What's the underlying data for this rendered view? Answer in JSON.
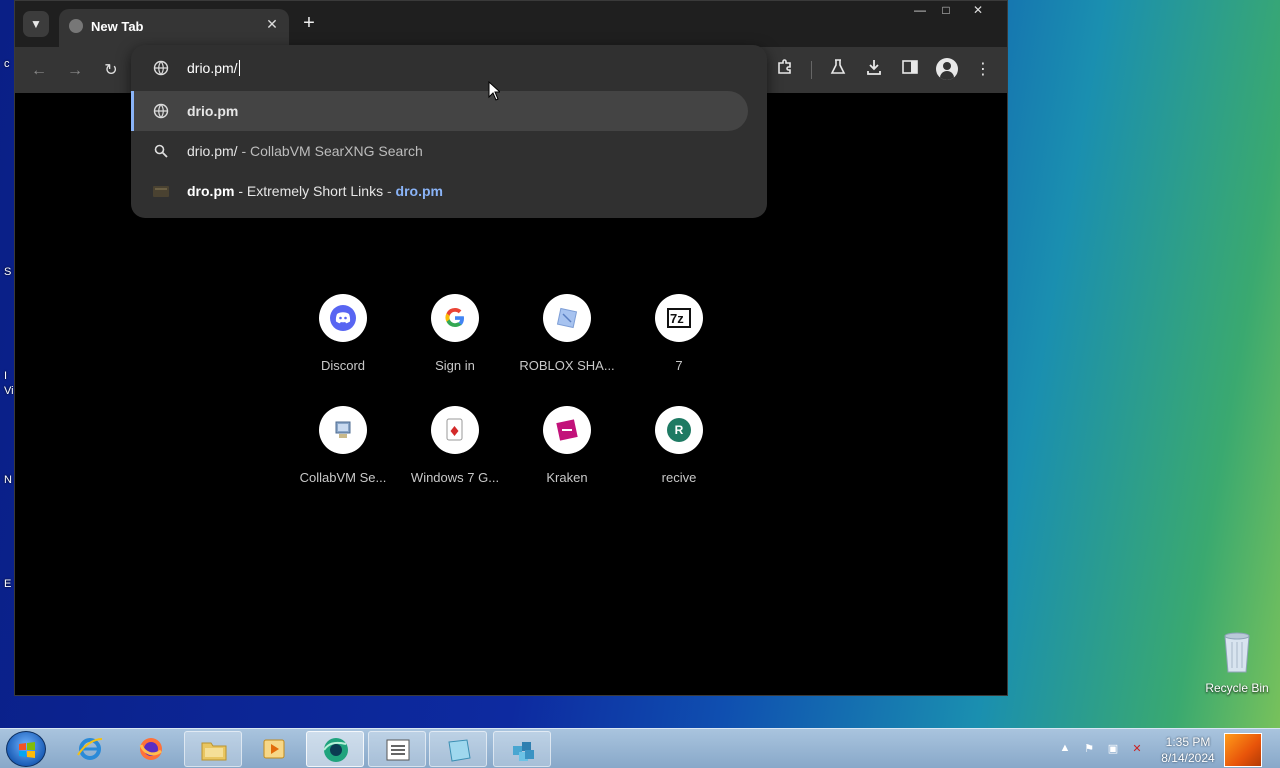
{
  "browser": {
    "tab_title": "New Tab",
    "omnibox_text": "drio.pm/",
    "suggestions": [
      {
        "main": "drio.pm",
        "sep": "",
        "desc": "",
        "url": ""
      },
      {
        "main": "drio.pm/",
        "sep": " - ",
        "desc": "CollabVM SearXNG Search",
        "url": ""
      },
      {
        "main": "dro.pm",
        "sep": " - ",
        "desc": "Extremely Short Links",
        "sep2": " - ",
        "url": "dro.pm"
      }
    ],
    "shortcuts": [
      {
        "label": "Discord",
        "icon": "discord-icon"
      },
      {
        "label": "Sign in",
        "icon": "google-icon"
      },
      {
        "label": "ROBLOX SHA...",
        "icon": "roblox-icon"
      },
      {
        "label": "7",
        "icon": "7zip-icon"
      },
      {
        "label": "CollabVM Se...",
        "icon": "collabvm-icon"
      },
      {
        "label": "Windows 7 G...",
        "icon": "solitaire-icon"
      },
      {
        "label": "Kraken",
        "icon": "kraken-icon"
      },
      {
        "label": "recive",
        "icon": "letter-r-icon",
        "letter": "R"
      }
    ],
    "accent": "#8ab4f8"
  },
  "desktop": {
    "recycle_bin_label": "Recycle Bin",
    "edge_fragments": [
      "c",
      "S",
      "I",
      "Vi",
      "N",
      "E"
    ]
  },
  "taskbar": {
    "time": "1:35 PM",
    "date": "8/14/2024"
  }
}
